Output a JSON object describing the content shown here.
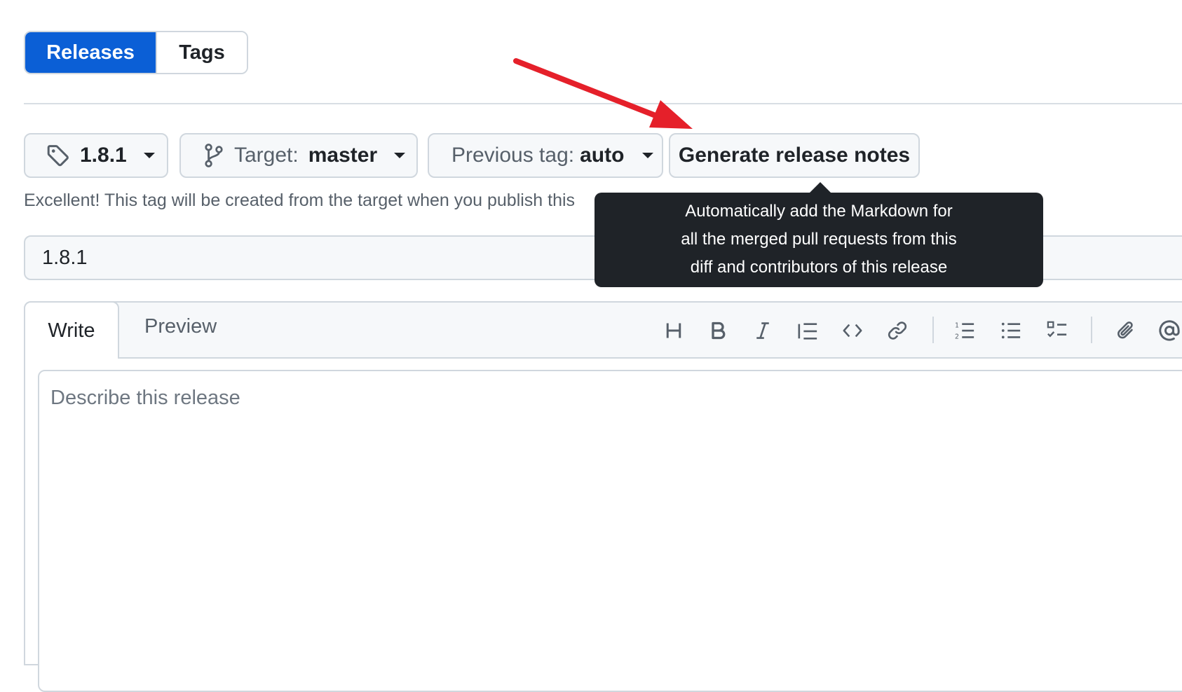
{
  "tabs": {
    "releases": "Releases",
    "tags": "Tags"
  },
  "toolbar": {
    "tag_value": "1.8.1",
    "target_label": "Target:",
    "target_value": "master",
    "previous_tag_label": "Previous tag:",
    "previous_tag_value": "auto",
    "generate_label": "Generate release notes"
  },
  "hint": "Excellent! This tag will be created from the target when you publish this",
  "tooltip": {
    "line1": "Automatically add the Markdown for",
    "line2": "all the merged pull requests from this",
    "line3": "diff and contributors of this release"
  },
  "title_input": {
    "value": "1.8.1"
  },
  "editor": {
    "write_tab": "Write",
    "preview_tab": "Preview",
    "placeholder": "Describe this release",
    "tools": [
      "heading-icon",
      "bold-icon",
      "italic-icon",
      "quote-icon",
      "code-icon",
      "link-icon",
      "ordered-list-icon",
      "unordered-list-icon",
      "task-list-icon",
      "attach-icon",
      "mention-icon"
    ]
  },
  "colors": {
    "accent": "#0b5fd6",
    "tooltip_bg": "#1f2328",
    "arrow": "#e5202a"
  }
}
